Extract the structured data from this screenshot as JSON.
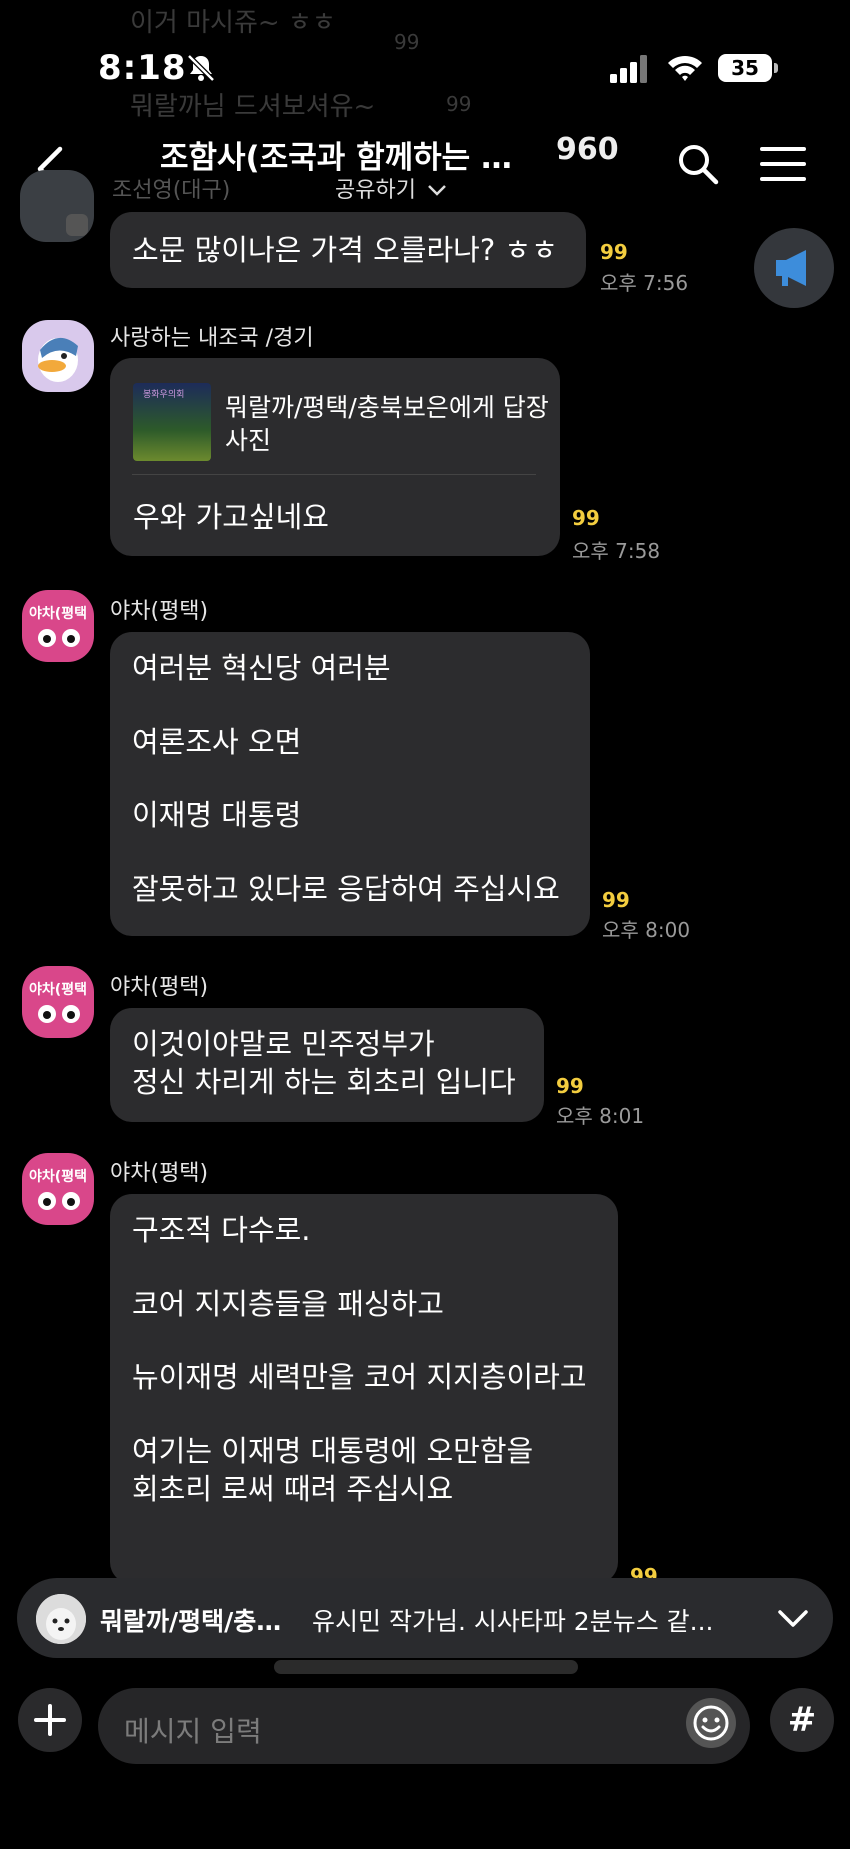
{
  "status_bar": {
    "time": "8:18",
    "battery": "35"
  },
  "background_ghost": {
    "line1": "이거 마시쥬~ ㅎㅎ",
    "count1": "99",
    "line2": "뭐랄까님 드셔보셔유~",
    "count2": "99",
    "partial_sender": "조선영(대구)"
  },
  "header": {
    "title": "조함사(조국과 함께하는 사...",
    "member_count": "960",
    "share_label": "공유하기"
  },
  "messages": [
    {
      "sender": "",
      "lines": [
        "소문 많이나은 가격 오를라나? ㅎㅎ"
      ],
      "unread": "99",
      "time": "오후 7:56"
    },
    {
      "sender": "사랑하는 내조국 /경기",
      "reply_to": [
        "뭐랄까/평택/충북보은에게 답장",
        "사진"
      ],
      "lines": [
        "우와 가고싶네요"
      ],
      "unread": "99",
      "time": "오후 7:58"
    },
    {
      "sender": "야차(평택)",
      "lines": [
        "여러분 혁신당 여러분",
        "여론조사 오면",
        "이재명 대통령",
        "잘못하고 있다로 응답하여 주십시요"
      ],
      "unread": "99",
      "time": "오후 8:00"
    },
    {
      "sender": "야차(평택)",
      "lines": [
        "이것이야말로 민주정부가",
        "정신 차리게 하는 회초리 입니다"
      ],
      "unread": "99",
      "time": "오후 8:01"
    },
    {
      "sender": "야차(평택)",
      "lines": [
        "구조적 다수로.",
        "코어 지지층들을 패싱하고",
        "뉴이재명 세력만을 코어 지지층이라고",
        "여기는 이재명 대통령에 오만함을",
        "회초리 로써 때려 주십시요"
      ],
      "unread": "99"
    }
  ],
  "avatar_text": "야차(평택",
  "reply_thumb_text": "봉화우의회",
  "preview": {
    "sender": "뭐랄까/평택/충…",
    "message": "유시민 작가님. 시사타파 2분뉴스 같..."
  },
  "input": {
    "placeholder": "메시지 입력",
    "hash_label": "#"
  },
  "colors": {
    "background": "#000000",
    "bubble": "#2c2c2e",
    "unread": "#f3cd3f",
    "avatar_pink": "#d9478a",
    "notice_blue": "#3d8ddb"
  },
  "icons": [
    "back-arrow-icon",
    "search-icon",
    "menu-icon",
    "megaphone-icon",
    "chevron-down-icon",
    "plus-icon",
    "emoji-icon",
    "bell-slash-icon",
    "signal-icon",
    "wifi-icon"
  ]
}
